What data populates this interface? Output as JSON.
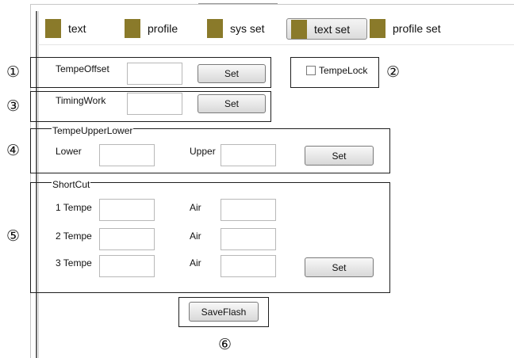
{
  "tabs": [
    {
      "label": "text",
      "active": false
    },
    {
      "label": "profile",
      "active": false
    },
    {
      "label": "sys set",
      "active": false
    },
    {
      "label": "text set",
      "active": true
    },
    {
      "label": "profile set",
      "active": false
    }
  ],
  "markers": {
    "m1": "①",
    "m2": "②",
    "m3": "③",
    "m4": "④",
    "m5": "⑤",
    "m6": "⑥"
  },
  "tempe_offset": {
    "label": "TempeOffset",
    "value": "",
    "set_label": "Set"
  },
  "tempe_lock": {
    "label": "TempeLock",
    "checked": false
  },
  "timing_work": {
    "label": "TimingWork",
    "value": "",
    "set_label": "Set"
  },
  "tempe_upper_lower": {
    "legend": "TempeUpperLower",
    "lower_label": "Lower",
    "lower_value": "",
    "upper_label": "Upper",
    "upper_value": "",
    "set_label": "Set"
  },
  "shortcut": {
    "legend": "ShortCut",
    "rows": [
      {
        "tempe_label": "1 Tempe",
        "tempe_value": "",
        "air_label": "Air",
        "air_value": ""
      },
      {
        "tempe_label": "2 Tempe",
        "tempe_value": "",
        "air_label": "Air",
        "air_value": ""
      },
      {
        "tempe_label": "3 Tempe",
        "tempe_value": "",
        "air_label": "Air",
        "air_value": ""
      }
    ],
    "set_label": "Set"
  },
  "save_flash": {
    "label": "SaveFlash"
  },
  "colors": {
    "tab_square": "#8a7a2a",
    "group_border": "#1e1e1e"
  }
}
